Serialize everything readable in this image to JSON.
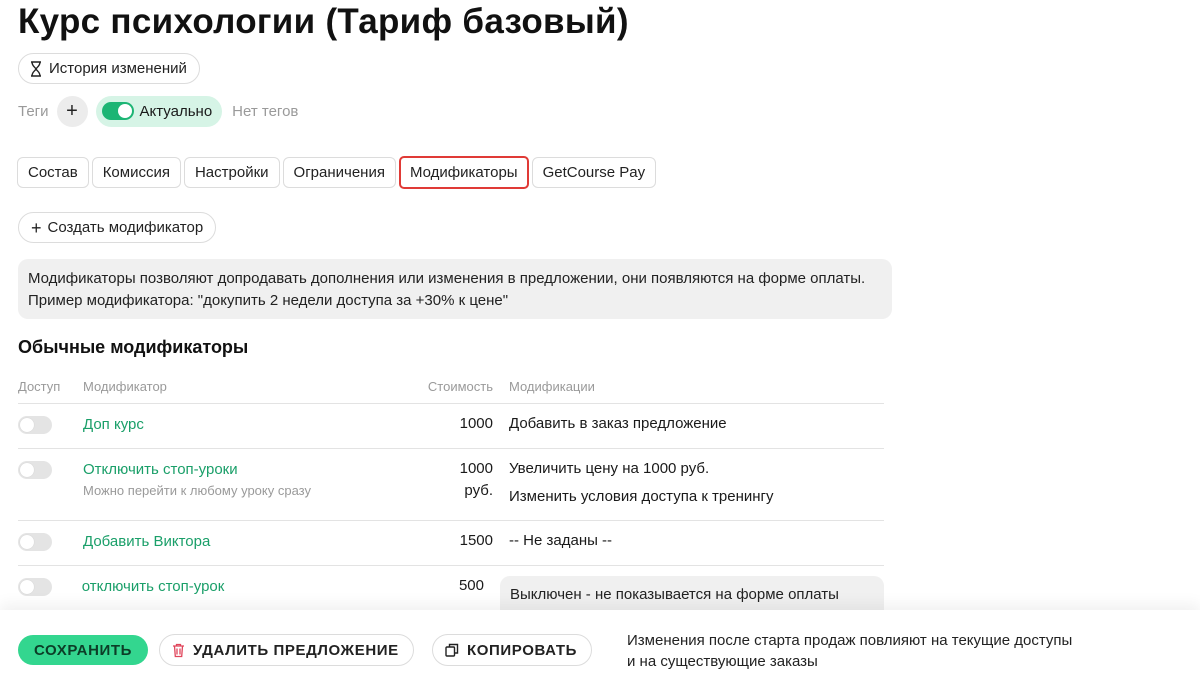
{
  "title": "Курс психологии (Тариф базовый)",
  "history_button": {
    "label": "История изменений",
    "icon": "hourglass-icon"
  },
  "tags": {
    "label": "Теги",
    "add_icon": "plus-icon",
    "status_label": "Актуально",
    "status_on": true,
    "empty_label": "Нет тегов"
  },
  "tabs": [
    {
      "label": "Состав",
      "active": false
    },
    {
      "label": "Комиссия",
      "active": false
    },
    {
      "label": "Настройки",
      "active": false
    },
    {
      "label": "Ограничения",
      "active": false
    },
    {
      "label": "Модификаторы",
      "active": true
    },
    {
      "label": "GetCourse Pay",
      "active": false
    }
  ],
  "create_button": {
    "label": "Создать модификатор",
    "icon": "plus-icon"
  },
  "info_text": "Модификаторы позволяют допродавать дополнения или изменения в предложении, они появляются на форме оплаты. Пример модификатора: \"докупить 2 недели доступа за +30% к цене\"",
  "section_title": "Обычные модификаторы",
  "table": {
    "headers": {
      "access": "Доступ",
      "modifier": "Модификатор",
      "cost": "Стоимость",
      "changes": "Модификации"
    },
    "rows": [
      {
        "enabled": false,
        "name": "Доп курс",
        "subtitle": "",
        "cost": "1000",
        "cost_unit": "",
        "changes": [
          "Добавить в заказ предложение"
        ]
      },
      {
        "enabled": false,
        "name": "Отключить стоп-уроки",
        "subtitle": "Можно перейти к любому уроку сразу",
        "cost": "1000",
        "cost_unit": "руб.",
        "changes": [
          "Увеличить цену на 1000 руб.",
          "Изменить условия доступа к тренингу"
        ]
      },
      {
        "enabled": false,
        "name": "Добавить Виктора",
        "subtitle": "",
        "cost": "1500",
        "cost_unit": "",
        "changes": [
          "-- Не заданы --"
        ]
      },
      {
        "enabled": false,
        "name": "отключить стоп-урок",
        "subtitle": "",
        "cost": "500",
        "cost_unit": "",
        "changes": [],
        "note": "Выключен - не показывается на форме оплаты"
      }
    ]
  },
  "footer": {
    "save_label": "СОХРАНИТЬ",
    "delete_label": "УДАЛИТЬ ПРЕДЛОЖЕНИЕ",
    "delete_icon": "trash-icon",
    "copy_label": "КОПИРОВАТЬ",
    "copy_icon": "copy-icon",
    "note_line1": "Изменения после старта продаж повлияют на текущие доступы",
    "note_line2": "и на существующие заказы"
  },
  "colors": {
    "accent_green": "#1cb574",
    "link_green": "#1a9f69",
    "save_green": "#33d68f",
    "active_tab_border": "#e03a36",
    "delete_icon_red": "#e0445a"
  }
}
